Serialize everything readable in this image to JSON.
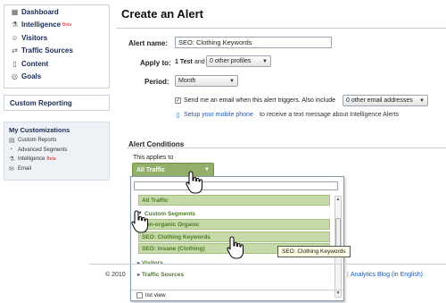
{
  "sidebar": {
    "nav": [
      {
        "label": "Dashboard",
        "icon": "dashboard-icon",
        "badge": ""
      },
      {
        "label": "Intelligence",
        "icon": "intelligence-icon",
        "badge": "Beta"
      },
      {
        "label": "Visitors",
        "icon": "visitors-icon",
        "badge": ""
      },
      {
        "label": "Traffic Sources",
        "icon": "traffic-sources-icon",
        "badge": ""
      },
      {
        "label": "Content",
        "icon": "content-icon",
        "badge": ""
      },
      {
        "label": "Goals",
        "icon": "goals-icon",
        "badge": ""
      }
    ],
    "custom_reporting": "Custom Reporting",
    "customizations": {
      "title": "My Customizations",
      "items": [
        {
          "label": "Custom Reports",
          "icon": "custom-reports-icon",
          "badge": ""
        },
        {
          "label": "Advanced Segments",
          "icon": "advanced-segments-icon",
          "badge": ""
        },
        {
          "label": "Intelligence",
          "icon": "intelligence-icon",
          "badge": "Beta"
        },
        {
          "label": "Email",
          "icon": "email-icon",
          "badge": ""
        }
      ]
    }
  },
  "main": {
    "title": "Create an Alert",
    "alert_name_label": "Alert name:",
    "alert_name_value": "SEO: Clothing Keywords",
    "apply_to_label": "Apply to:",
    "apply_to_count": "1 Test",
    "apply_to_and": "and",
    "profiles_select": "0 other profiles",
    "period_label": "Period:",
    "period_select": "Month",
    "email_checkbox_checked": true,
    "email_text": "Send me an email when this alert triggers. Also include",
    "email_select": "0 other email addresses",
    "mobile_link": "Setup your mobile phone",
    "mobile_text": "to receive a text message about Intelligence Alerts",
    "conditions_title": "Alert Conditions",
    "applies_to_label": "This applies to",
    "applies_to_value": "All Traffic"
  },
  "dropdown": {
    "all_traffic": "All Traffic",
    "custom_segments": "Custom Segments",
    "options": [
      "Non-organic Organic",
      "SEO: Clothing Keywords",
      "SEO: Insane (Clothing)"
    ],
    "visitors": "Visitors",
    "traffic_sources": "Traffic Sources",
    "list_view": "list view"
  },
  "tooltip": "SEO: Clothing Keywords",
  "footer": {
    "copyright": "© 2010",
    "blog_link": "Analytics Blog (in English)",
    "separator": "|"
  },
  "colors": {
    "accent_green": "#93b06a",
    "highlight_green": "#c6d9a8",
    "link_blue": "#1f58b3",
    "nav_text": "#1a2a55",
    "beta_red": "#d62020"
  }
}
